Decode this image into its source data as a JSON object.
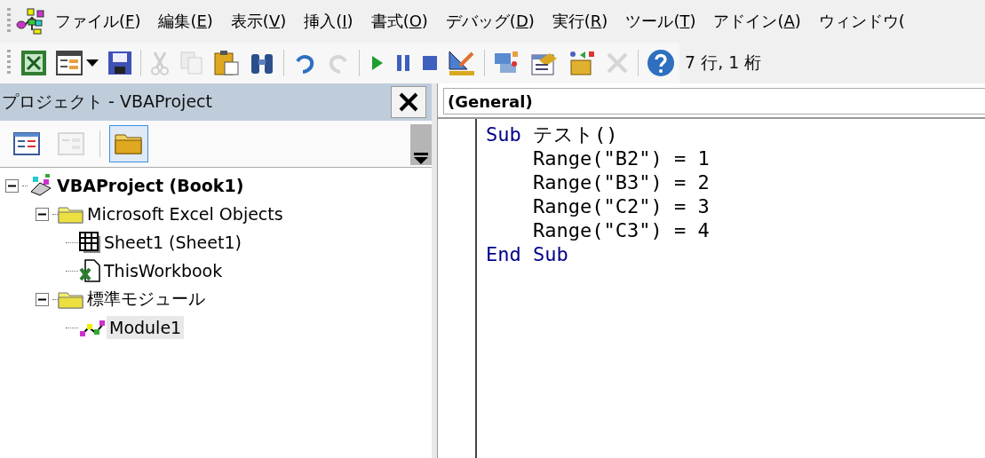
{
  "menu": [
    {
      "prefix": "ファイル(",
      "key": "F",
      "suffix": ")"
    },
    {
      "prefix": "編集(",
      "key": "E",
      "suffix": ")"
    },
    {
      "prefix": "表示(",
      "key": "V",
      "suffix": ")"
    },
    {
      "prefix": "挿入(",
      "key": "I",
      "suffix": ")"
    },
    {
      "prefix": "書式(",
      "key": "O",
      "suffix": ")"
    },
    {
      "prefix": "デバッグ(",
      "key": "D",
      "suffix": ")"
    },
    {
      "prefix": "実行(",
      "key": "R",
      "suffix": ")"
    },
    {
      "prefix": "ツール(",
      "key": "T",
      "suffix": ")"
    },
    {
      "prefix": "アドイン(",
      "key": "A",
      "suffix": ")"
    },
    {
      "prefix": "ウィンドウ("
    }
  ],
  "toolbar": {
    "items": [
      {
        "kind": "excel",
        "disabled": false
      },
      {
        "kind": "userform",
        "disabled": false
      },
      {
        "kind": "save",
        "disabled": false
      },
      {
        "kind": "separator"
      },
      {
        "kind": "cut",
        "disabled": true
      },
      {
        "kind": "copy",
        "disabled": true
      },
      {
        "kind": "paste",
        "disabled": false
      },
      {
        "kind": "find",
        "disabled": false
      },
      {
        "kind": "separator"
      },
      {
        "kind": "undo",
        "disabled": false
      },
      {
        "kind": "redo",
        "disabled": true
      },
      {
        "kind": "separator"
      },
      {
        "kind": "run",
        "disabled": false
      },
      {
        "kind": "pause",
        "disabled": false
      },
      {
        "kind": "stop",
        "disabled": false
      },
      {
        "kind": "design",
        "disabled": false
      },
      {
        "kind": "separator"
      },
      {
        "kind": "explorer",
        "disabled": false
      },
      {
        "kind": "properties",
        "disabled": false
      },
      {
        "kind": "browser",
        "disabled": false
      },
      {
        "kind": "toolbox",
        "disabled": true
      },
      {
        "kind": "separator"
      },
      {
        "kind": "help",
        "disabled": false
      }
    ],
    "position": "7 行, 1 桁"
  },
  "project": {
    "title": "プロジェクト - VBAProject",
    "buttons": [
      {
        "kind": "code",
        "disabled": false,
        "pressed": false
      },
      {
        "kind": "object",
        "disabled": true,
        "pressed": false
      },
      {
        "kind": "folders",
        "disabled": false,
        "pressed": true
      }
    ],
    "tree": [
      {
        "label": "VBAProject (Book1)",
        "kind": "project",
        "expanded": true,
        "selected": false,
        "children": [
          {
            "label": "Microsoft Excel Objects",
            "kind": "folder",
            "expanded": true,
            "selected": false,
            "children": [
              {
                "label": "Sheet1 (Sheet1)",
                "kind": "sheet",
                "selected": false
              },
              {
                "label": "ThisWorkbook",
                "kind": "workbook",
                "selected": false
              }
            ]
          },
          {
            "label": "標準モジュール",
            "kind": "folder",
            "expanded": true,
            "selected": false,
            "children": [
              {
                "label": "Module1",
                "kind": "module",
                "selected": true
              }
            ]
          }
        ]
      }
    ]
  },
  "code": {
    "object": "(General)",
    "lines": [
      [
        {
          "text": "Sub",
          "kind": "keyword"
        },
        {
          "text": " テスト()",
          "kind": "plain"
        }
      ],
      [
        {
          "text": "    Range(\"B2\") = 1",
          "kind": "plain"
        }
      ],
      [
        {
          "text": "    Range(\"B3\") = 2",
          "kind": "plain"
        }
      ],
      [
        {
          "text": "    Range(\"C2\") = 3",
          "kind": "plain"
        }
      ],
      [
        {
          "text": "    Range(\"C3\") = 4",
          "kind": "plain"
        }
      ],
      [
        {
          "text": "End Sub",
          "kind": "keyword"
        }
      ]
    ]
  }
}
